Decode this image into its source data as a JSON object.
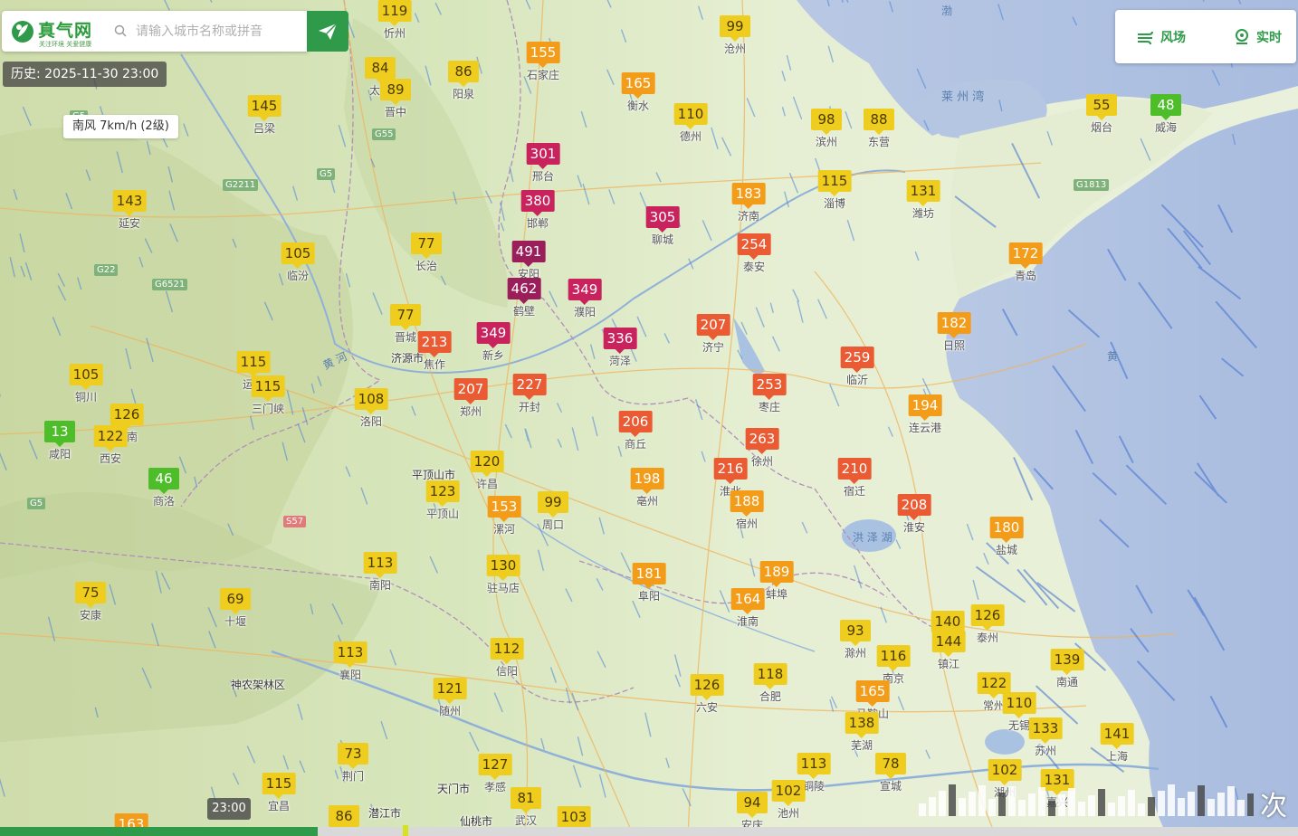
{
  "header": {
    "logo_text": "真气网",
    "logo_slogan": "关注环境 关爱健康",
    "search_placeholder": "请输入城市名称或拼音"
  },
  "history_label": "历史: 2025-11-30 23:00",
  "wind_label": "南风 7km/h (2级)",
  "right_panel": {
    "wind_field": "风场",
    "realtime": "实时"
  },
  "timeline": {
    "time_label": "23:00",
    "progress": 0.245
  },
  "next_label": "次",
  "colors": {
    "good": "#4dbd2a",
    "moderate": "#efcd1e",
    "light": "#f39c1a",
    "medium": "#ea5a33",
    "heavy": "#c8235c",
    "severe": "#9a1e5a",
    "brand": "#2f9a4a"
  },
  "markers": [
    {
      "v": "119",
      "n": "忻州"
    },
    {
      "v": "99",
      "n": "沧州"
    },
    {
      "v": "155",
      "n": "石家庄"
    },
    {
      "v": "84",
      "n": "太原"
    },
    {
      "v": "89",
      "n": "晋中"
    },
    {
      "v": "86",
      "n": "阳泉"
    },
    {
      "v": "165",
      "n": "衡水"
    },
    {
      "v": "110",
      "n": "德州"
    },
    {
      "v": "98",
      "n": "滨州"
    },
    {
      "v": "88",
      "n": "东营"
    },
    {
      "v": "55",
      "n": "烟台"
    },
    {
      "v": "48",
      "n": "威海"
    },
    {
      "v": "145",
      "n": "吕梁"
    },
    {
      "v": "301",
      "n": "邢台"
    },
    {
      "v": "380",
      "n": "邯郸"
    },
    {
      "v": "305",
      "n": "聊城"
    },
    {
      "v": "183",
      "n": "济南"
    },
    {
      "v": "115",
      "n": "淄博"
    },
    {
      "v": "131",
      "n": "潍坊"
    },
    {
      "v": "143",
      "n": "延安"
    },
    {
      "v": "105",
      "n": "临汾"
    },
    {
      "v": "77",
      "n": "长治"
    },
    {
      "v": "491",
      "n": "安阳"
    },
    {
      "v": "254",
      "n": "泰安"
    },
    {
      "v": "172",
      "n": "青岛"
    },
    {
      "v": "462",
      "n": "鹤壁"
    },
    {
      "v": "349",
      "n": "濮阳"
    },
    {
      "v": "77",
      "n": "晋城"
    },
    {
      "v": "213",
      "n": "焦作"
    },
    {
      "v": "349",
      "n": "新乡"
    },
    {
      "v": "336",
      "n": "菏泽"
    },
    {
      "v": "207",
      "n": "济宁"
    },
    {
      "v": "182",
      "n": "日照"
    },
    {
      "v": "115",
      "n": "运城"
    },
    {
      "v": "105",
      "n": "铜川"
    },
    {
      "v": "115",
      "n": "三门峡"
    },
    {
      "v": "259",
      "n": "临沂"
    },
    {
      "v": "108",
      "n": "洛阳"
    },
    {
      "v": "207",
      "n": "郑州"
    },
    {
      "v": "227",
      "n": "开封"
    },
    {
      "v": "253",
      "n": "枣庄"
    },
    {
      "v": "126",
      "n": "渭南"
    },
    {
      "v": "13",
      "n": "咸阳"
    },
    {
      "v": "122",
      "n": "西安"
    },
    {
      "v": "206",
      "n": "商丘"
    },
    {
      "v": "194",
      "n": "连云港"
    },
    {
      "v": "263",
      "n": "徐州"
    },
    {
      "v": "46",
      "n": "商洛"
    },
    {
      "v": "120",
      "n": "许昌"
    },
    {
      "v": "216",
      "n": "淮北"
    },
    {
      "v": "198",
      "n": "亳州"
    },
    {
      "v": "210",
      "n": "宿迁"
    },
    {
      "v": "123",
      "n": "平顶山"
    },
    {
      "v": "153",
      "n": "漯河"
    },
    {
      "v": "99",
      "n": "周口"
    },
    {
      "v": "188",
      "n": "宿州"
    },
    {
      "v": "208",
      "n": "淮安"
    },
    {
      "v": "180",
      "n": "盐城"
    },
    {
      "v": "113",
      "n": "南阳"
    },
    {
      "v": "130",
      "n": "驻马店"
    },
    {
      "v": "181",
      "n": "阜阳"
    },
    {
      "v": "189",
      "n": "蚌埠"
    },
    {
      "v": "75",
      "n": "安康"
    },
    {
      "v": "69",
      "n": "十堰"
    },
    {
      "v": "164",
      "n": "淮南"
    },
    {
      "v": "140",
      "n": "扬州"
    },
    {
      "v": "126",
      "n": "泰州"
    },
    {
      "v": "93",
      "n": "滁州"
    },
    {
      "v": "116",
      "n": "南京"
    },
    {
      "v": "144",
      "n": "镇江"
    },
    {
      "v": "113",
      "n": "襄阳"
    },
    {
      "v": "112",
      "n": "信阳"
    },
    {
      "v": "139",
      "n": "南通"
    },
    {
      "v": "126",
      "n": "六安"
    },
    {
      "v": "118",
      "n": "合肥"
    },
    {
      "v": "122",
      "n": "常州"
    },
    {
      "v": "121",
      "n": "随州"
    },
    {
      "v": "165",
      "n": "马鞍山"
    },
    {
      "v": "110",
      "n": "无锡"
    },
    {
      "v": "138",
      "n": "芜湖"
    },
    {
      "v": "133",
      "n": "苏州"
    },
    {
      "v": "141",
      "n": "上海"
    },
    {
      "v": "73",
      "n": "荆门"
    },
    {
      "v": "127",
      "n": "孝感"
    },
    {
      "v": "113",
      "n": "铜陵"
    },
    {
      "v": "78",
      "n": "宣城"
    },
    {
      "v": "102",
      "n": "湖州"
    },
    {
      "v": "131",
      "n": "嘉兴"
    },
    {
      "v": "115",
      "n": "宜昌"
    },
    {
      "v": "86",
      "n": "潜江"
    },
    {
      "v": "81",
      "n": "武汉"
    },
    {
      "v": "94",
      "n": "安庆"
    },
    {
      "v": "102",
      "n": "池州"
    },
    {
      "v": "103",
      "n": "鄂州"
    },
    {
      "v": "163",
      "n": "恩施"
    }
  ],
  "places": {
    "shennongjia": "神农架林区",
    "tianmen": "天门市",
    "qianjiang": "潜江市",
    "xiantao": "仙桃市",
    "pingdingshan_city": "平顶山市",
    "jiyuan": "济源市",
    "yanzhou": "兖州",
    "hongze": "洪 泽 湖",
    "yellow_river": "黄 河",
    "laizhou_bay": "莱 州 湾",
    "bohai": "渤",
    "yellow_sea": "黄"
  }
}
